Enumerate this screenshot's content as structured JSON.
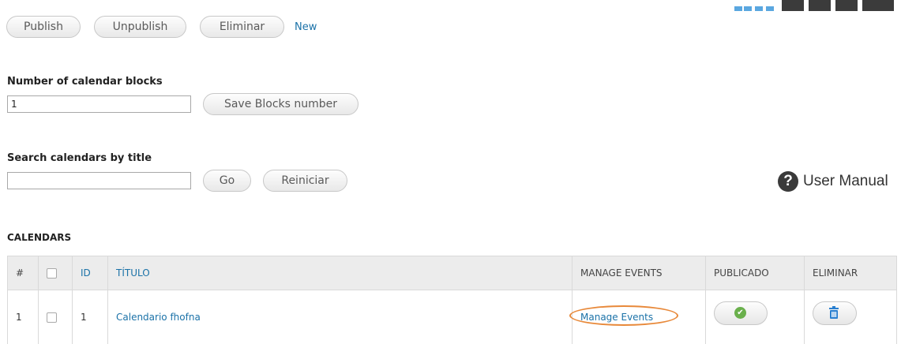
{
  "toolbar": {
    "publish_label": "Publish",
    "unpublish_label": "Unpublish",
    "delete_label": "Eliminar",
    "new_label": "New"
  },
  "blocks": {
    "label": "Number of calendar blocks",
    "value": "1",
    "save_label": "Save Blocks number"
  },
  "search": {
    "label": "Search calendars by title",
    "value": "",
    "go_label": "Go",
    "reset_label": "Reiniciar"
  },
  "help": {
    "icon": "question-icon",
    "label": "User Manual"
  },
  "calendars": {
    "section_title": "CALENDARS",
    "columns": {
      "num": "#",
      "id": "ID",
      "title": "TÍTULO",
      "manage": "MANAGE EVENTS",
      "published": "PUBLICADO",
      "delete": "ELIMINAR"
    },
    "rows": [
      {
        "num": "1",
        "id": "1",
        "title": "Calendario fhofna",
        "manage": "Manage Events",
        "published": true
      }
    ]
  },
  "colors": {
    "link": "#1b72a8",
    "highlight_oval": "#e8893a",
    "published_icon": "#6ab04c",
    "delete_icon": "#2a7fd0"
  }
}
